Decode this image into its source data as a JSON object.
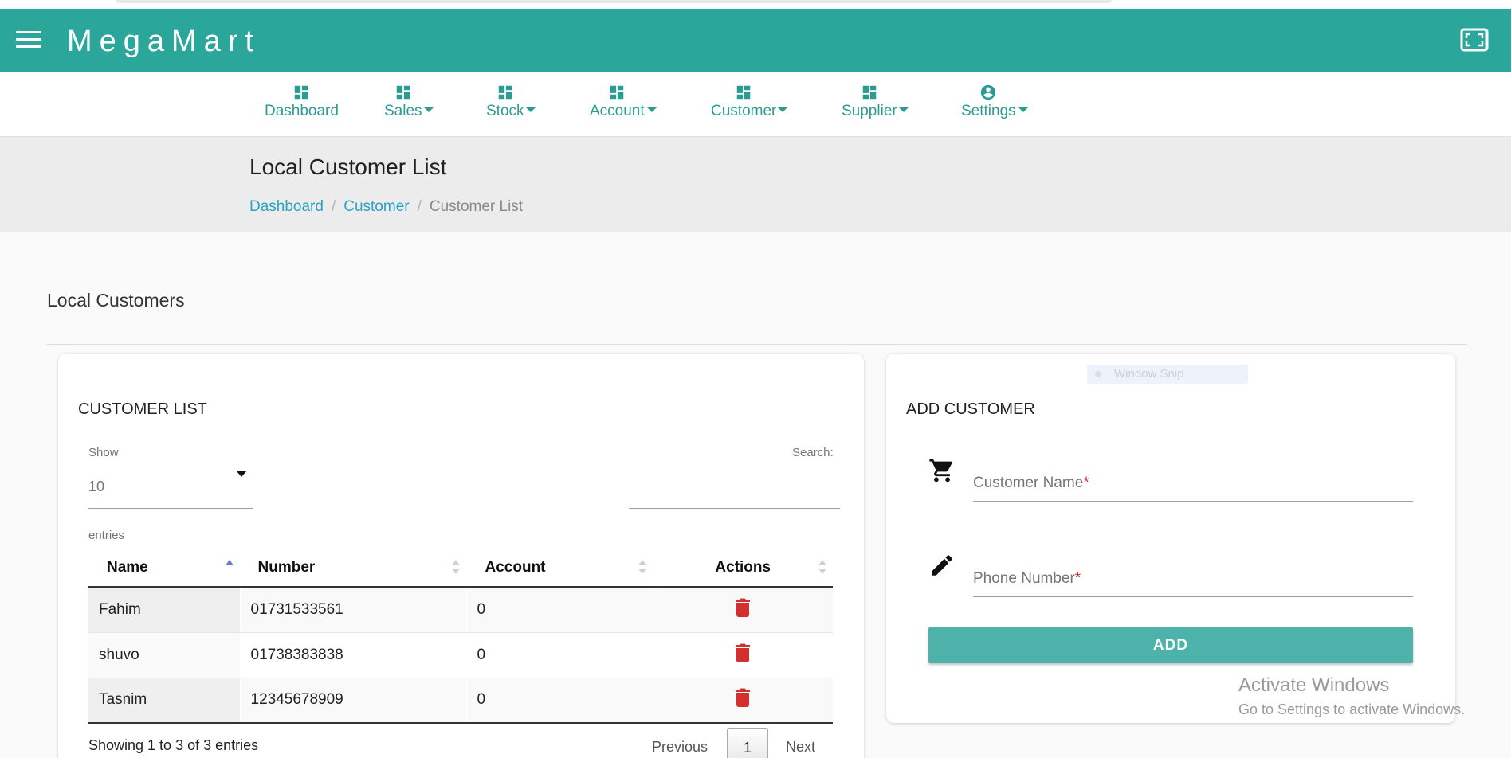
{
  "app": {
    "brand": "MegaMart"
  },
  "nav": {
    "items": [
      {
        "label": "Dashboard",
        "icon": "dashboard-icon",
        "has_caret": false
      },
      {
        "label": "Sales",
        "icon": "dashboard-icon",
        "has_caret": true
      },
      {
        "label": "Stock",
        "icon": "dashboard-icon",
        "has_caret": true
      },
      {
        "label": "Account",
        "icon": "dashboard-icon",
        "has_caret": true
      },
      {
        "label": "Customer",
        "icon": "dashboard-icon",
        "has_caret": true
      },
      {
        "label": "Supplier",
        "icon": "dashboard-icon",
        "has_caret": true
      },
      {
        "label": "Settings",
        "icon": "account-circle-icon",
        "has_caret": true
      }
    ]
  },
  "page": {
    "title": "Local Customer List",
    "breadcrumb": [
      "Dashboard",
      "Customer",
      "Customer List"
    ],
    "section_title": "Local Customers"
  },
  "customer_list": {
    "title": "CUSTOMER LIST",
    "show_label": "Show",
    "show_value": "10",
    "entries_label": "entries",
    "search_label": "Search:",
    "search_value": "",
    "columns": [
      "Name",
      "Number",
      "Account",
      "Actions"
    ],
    "sorted_column": "Name",
    "rows": [
      {
        "name": "Fahim",
        "number": "01731533561",
        "account": "0"
      },
      {
        "name": "shuvo",
        "number": "01738383838",
        "account": "0"
      },
      {
        "name": "Tasnim",
        "number": "12345678909",
        "account": "0"
      }
    ],
    "info": "Showing 1 to 3 of 3 entries",
    "pagination": {
      "previous": "Previous",
      "current_page": "1",
      "next": "Next"
    }
  },
  "add_customer": {
    "title": "ADD CUSTOMER",
    "name_label": "Customer Name",
    "phone_label": "Phone Number",
    "required_mark": "*",
    "button_label": "ADD"
  },
  "overlays": {
    "window_snip": "Window Snip",
    "activate_title": "Activate Windows",
    "activate_sub": "Go to Settings to activate Windows."
  },
  "colors": {
    "primary": "#2ba69b",
    "nav_text": "#2a9d92",
    "link": "#29a3c4",
    "delete": "#d32f2f",
    "add_button": "#4db3aa"
  }
}
